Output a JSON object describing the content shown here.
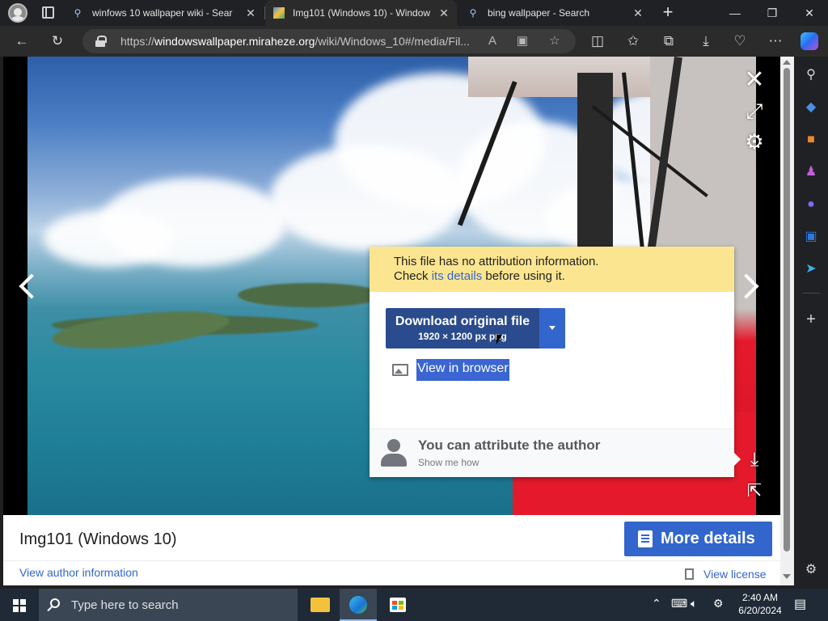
{
  "browser": {
    "tabs": [
      {
        "title": "winfows 10 wallpaper wiki - Sear",
        "favicon": "search-icon"
      },
      {
        "title": "Img101 (Windows 10) - Window",
        "favicon": "wiki-favicon"
      },
      {
        "title": "bing wallpaper - Search",
        "favicon": "search-icon"
      }
    ],
    "url_prefix": "https://",
    "url_host": "windowswallpaper.miraheze.org",
    "url_path": "/wiki/Windows_10#/media/Fil..."
  },
  "viewer": {
    "warning_line1": "This file has no attribution information.",
    "warning_check": "Check",
    "warning_link": "its details",
    "warning_rest": "before using it.",
    "download_label": "Download original file",
    "download_size": "1920 × 1200 px png",
    "view_in_browser": "View in browser",
    "attribute_title": "You can attribute the author",
    "attribute_sub": "Show me how"
  },
  "footer": {
    "file_title": "Img101 (Windows 10)",
    "more_details": "More details",
    "view_author": "View author information",
    "view_license": "View license"
  },
  "taskbar": {
    "search_placeholder": "Type here to search",
    "time": "2:40 AM",
    "date": "6/20/2024"
  },
  "colors": {
    "accent": "#3366cc",
    "dark_accent": "#2a4b8d",
    "warning_bg": "#fce590",
    "wing_red": "#e41a2c"
  }
}
